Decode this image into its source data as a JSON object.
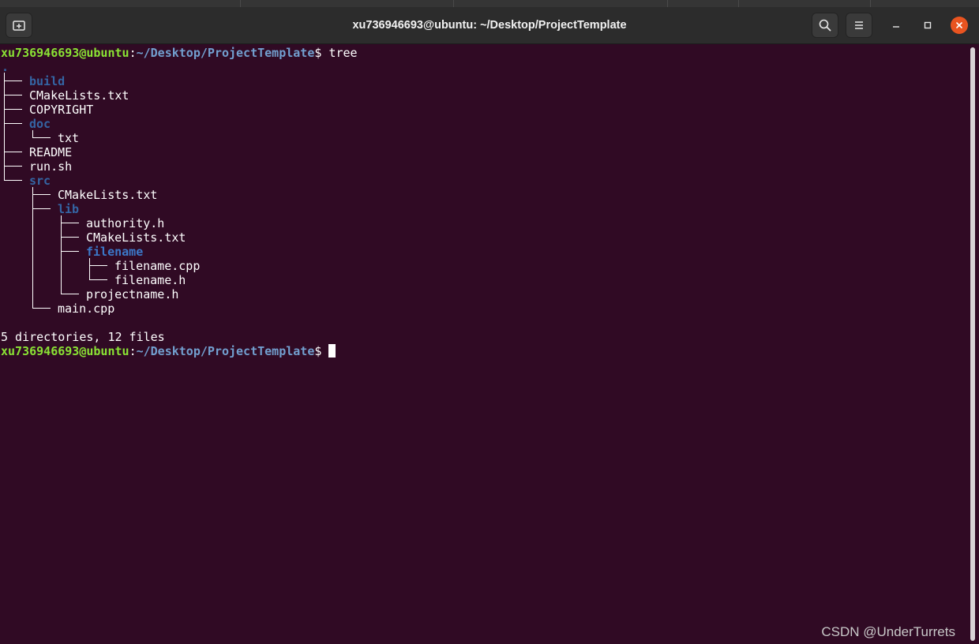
{
  "window": {
    "title": "xu736946693@ubuntu: ~/Desktop/ProjectTemplate"
  },
  "headerbar": {
    "new_tab_icon": "new-tab-icon",
    "search_icon": "search-icon",
    "menu_icon": "hamburger-menu-icon",
    "minimize_icon": "minimize-icon",
    "maximize_icon": "maximize-icon",
    "close_icon": "close-icon"
  },
  "prompt": {
    "user_host": "xu736946693@ubuntu",
    "colon": ":",
    "path": "~/Desktop/ProjectTemplate",
    "dollar": "$"
  },
  "command": "tree",
  "tree": {
    "root": ".",
    "entries": [
      {
        "name": "build",
        "type": "dir"
      },
      {
        "name": "CMakeLists.txt",
        "type": "file"
      },
      {
        "name": "COPYRIGHT",
        "type": "file"
      },
      {
        "name": "doc",
        "type": "dir"
      },
      {
        "name": "txt",
        "type": "file"
      },
      {
        "name": "README",
        "type": "file"
      },
      {
        "name": "run.sh",
        "type": "file"
      },
      {
        "name": "src",
        "type": "dir"
      },
      {
        "name": "CMakeLists.txt",
        "type": "file"
      },
      {
        "name": "lib",
        "type": "dir"
      },
      {
        "name": "authority.h",
        "type": "file"
      },
      {
        "name": "CMakeLists.txt",
        "type": "file"
      },
      {
        "name": "filename",
        "type": "dir"
      },
      {
        "name": "filename.cpp",
        "type": "file"
      },
      {
        "name": "filename.h",
        "type": "file"
      },
      {
        "name": "projectname.h",
        "type": "file"
      },
      {
        "name": "main.cpp",
        "type": "file"
      }
    ]
  },
  "summary": "5 directories, 12 files",
  "watermark": "CSDN @UnderTurrets",
  "colors": {
    "background": "#300a24",
    "user_host": "#8ae234",
    "path": "#729fcf",
    "directory": "#3465a4",
    "accent_close": "#e95420"
  }
}
